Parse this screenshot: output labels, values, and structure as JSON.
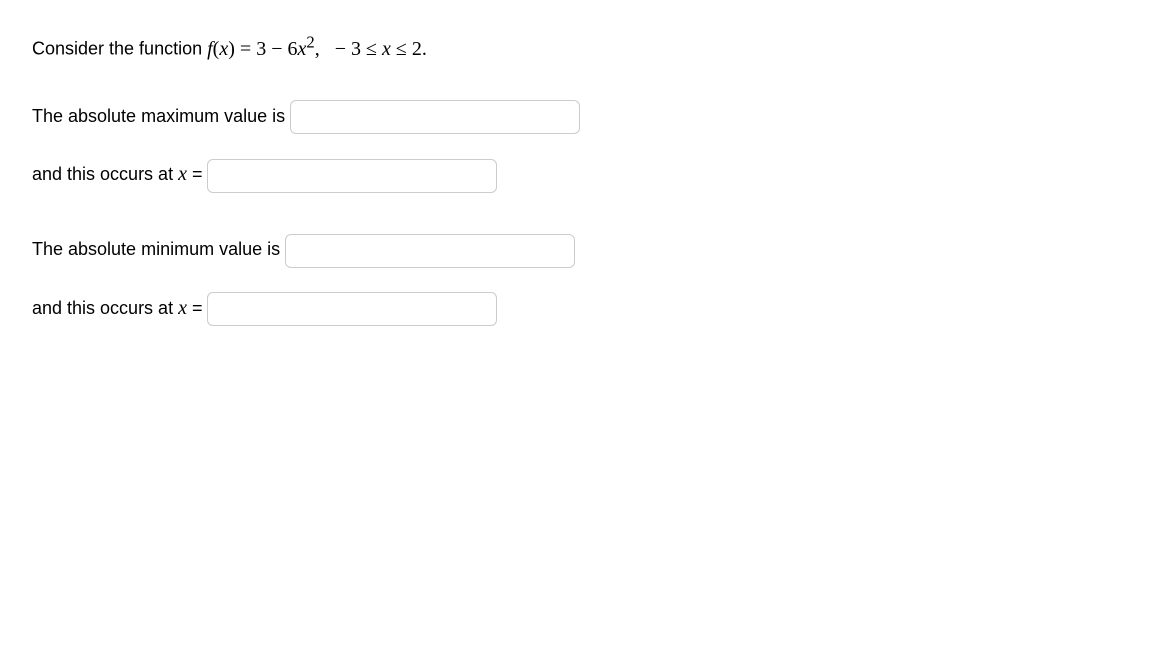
{
  "question": {
    "prefix": "Consider the function ",
    "func_lhs": "f",
    "func_open": "(",
    "func_var": "x",
    "func_close": ")",
    "equals": " = ",
    "rhs_a": "3 − 6",
    "rhs_var": "x",
    "rhs_exp": "2",
    "comma": ",",
    "domain": "   − 3 ≤ ",
    "domain_var": "x",
    "domain_end": " ≤ 2."
  },
  "max": {
    "label_value": "The absolute maximum value is ",
    "label_x_prefix": "and this occurs at ",
    "x_var": "x",
    "x_equals": " = "
  },
  "min": {
    "label_value": "The absolute minimum value is ",
    "label_x_prefix": "and this occurs at ",
    "x_var": "x",
    "x_equals": " = "
  }
}
